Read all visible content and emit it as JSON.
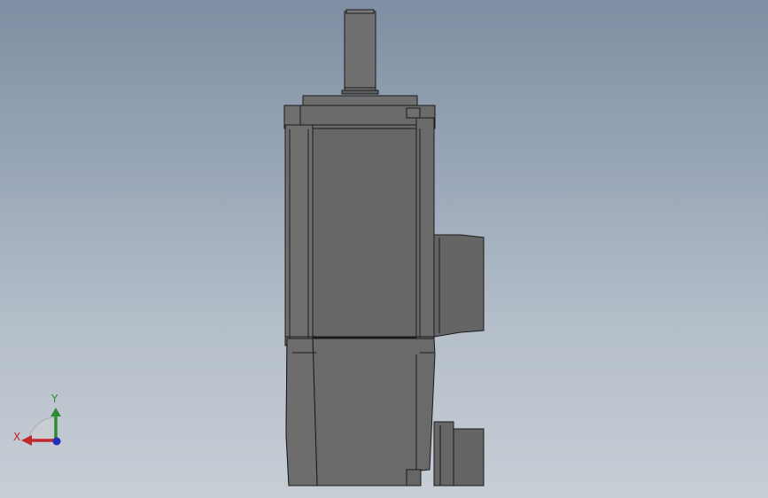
{
  "triad": {
    "x_label": "X",
    "y_label": "Y",
    "colors": {
      "x": "#c0282c",
      "y": "#2f8a38",
      "z": "#2030b8",
      "plane": "#c9ccd0"
    },
    "icon": "orientation-triad-icon"
  },
  "model": {
    "icon": "motor-side-view",
    "colors": {
      "body": "#6b6b6b",
      "body_dark": "#5e5e5e",
      "shaft": "#707070",
      "edge": "#1a1a1a"
    }
  }
}
